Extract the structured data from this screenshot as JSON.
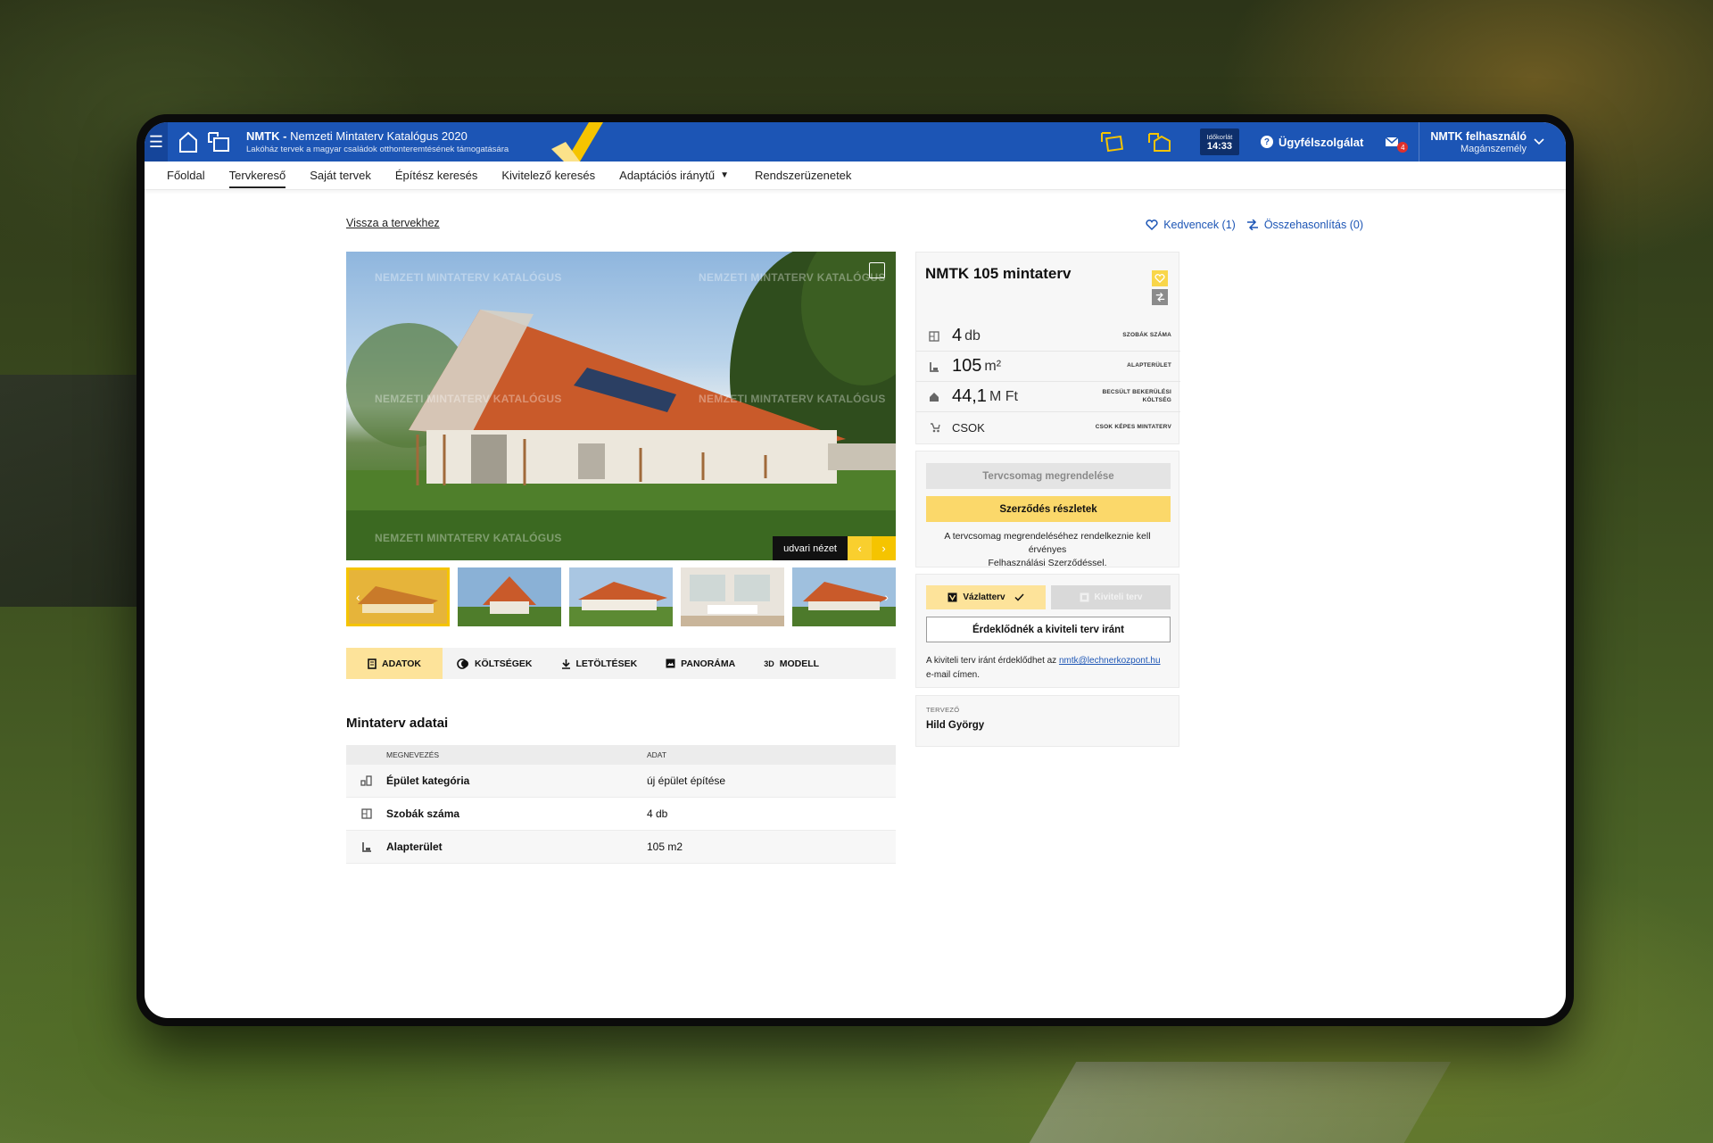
{
  "header": {
    "title_prefix": "NMTK - ",
    "title_rest": "Nemzeti Mintaterv Katalógus 2020",
    "subtitle": "Lakóház tervek a magyar családok otthonteremtésének támogatására",
    "timer_label": "Időkorlát",
    "timer_value": "14:33",
    "support_label": "Ügyfélszolgálat",
    "mail_count": "4",
    "user_name": "NMTK felhasználó",
    "user_role": "Magánszemély",
    "brand_color": "#1c55b5",
    "accent_color": "#f5c400"
  },
  "nav": {
    "items": [
      "Főoldal",
      "Tervkereső",
      "Saját tervek",
      "Építész keresés",
      "Kivitelező keresés",
      "Adaptációs iránytű",
      "Rendszerüzenetek"
    ],
    "active_index": 1
  },
  "page": {
    "back_link": "Vissza a tervekhez",
    "favorites_link": "Kedvencek (1)",
    "compare_link": "Összehasonlítás (0)"
  },
  "gallery": {
    "watermark": "NEMZETI MINTATERV KATALÓGUS",
    "view_label": "udvari nézet",
    "thumb_count": 5,
    "active_thumb": 0
  },
  "tabs": [
    {
      "label": "ADATOK",
      "icon": "document-icon",
      "active": true
    },
    {
      "label": "KÖLTSÉGEK",
      "icon": "coins-icon",
      "active": false
    },
    {
      "label": "LETÖLTÉSEK",
      "icon": "download-icon",
      "active": false
    },
    {
      "label": "PANORÁMA",
      "icon": "image-icon",
      "active": false
    },
    {
      "label": "MODELL",
      "icon": "3d-icon",
      "active": false,
      "prefix": "3D"
    }
  ],
  "details": {
    "title": "Mintaterv adatai",
    "col_name": "MEGNEVEZÉS",
    "col_value": "ADAT",
    "rows": [
      {
        "name": "Épület kategória",
        "value": "új épület építése",
        "icon": "building-icon"
      },
      {
        "name": "Szobák száma",
        "value": "4 db",
        "icon": "floorplan-icon"
      },
      {
        "name": "Alapterület",
        "value": "105 m2",
        "icon": "area-icon"
      }
    ]
  },
  "plan": {
    "title": "NMTK 105 mintaterv",
    "stats": [
      {
        "value": "4",
        "unit": "db",
        "label": "SZOBÁK SZÁMA",
        "icon": "floorplan-icon"
      },
      {
        "value": "105",
        "unit": "m²",
        "label": "ALAPTERÜLET",
        "icon": "area-icon"
      },
      {
        "value": "44,1",
        "unit": "M Ft",
        "label_line1": "BECSÜLT BEKERÜLÉSI",
        "label_line2": "KÖLTSÉG",
        "icon": "house-cost-icon"
      },
      {
        "value": "CSOK",
        "unit": "",
        "label": "CSOK KÉPES MINTATERV",
        "icon": "stroller-icon"
      }
    ]
  },
  "order": {
    "order_button": "Tervcsomag megrendelése",
    "contract_button": "Szerződés részletek",
    "note_line1": "A tervcsomag megrendeléséhez rendelkeznie kell érvényes",
    "note_line2": "Felhasználási Szerződéssel."
  },
  "plan_type": {
    "sketch_label": "Vázlatterv",
    "construction_label": "Kiviteli terv",
    "interest_button": "Érdeklődnék a kiviteli terv iránt",
    "note_prefix": "A kiviteli terv iránt érdeklődhet az ",
    "email": "nmtk@lechnerkozpont.hu",
    "note_suffix": "e-mail címen."
  },
  "designer": {
    "label": "TERVEZŐ",
    "name": "Hild György"
  }
}
